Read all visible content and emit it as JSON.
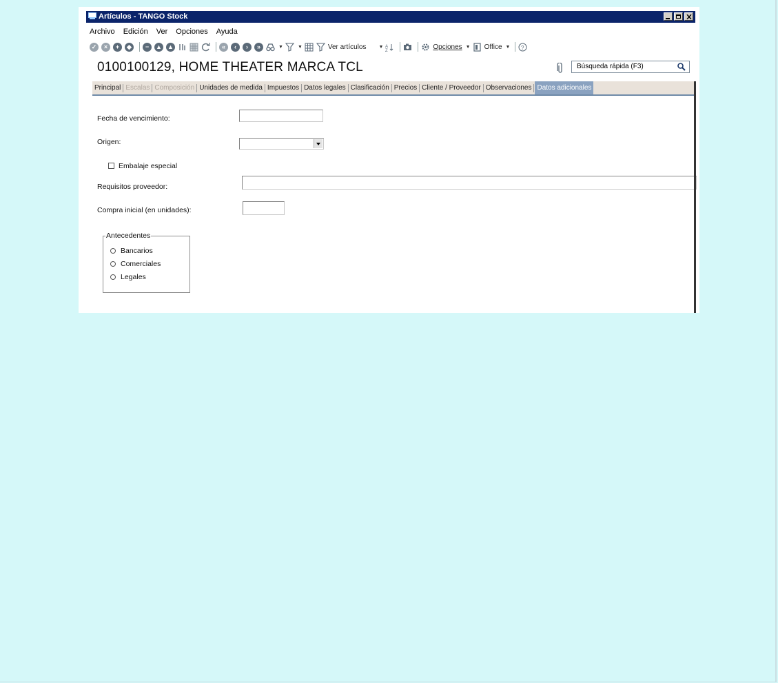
{
  "window": {
    "title": "Artículos - TANGO Stock"
  },
  "menu": [
    "Archivo",
    "Edición",
    "Ver",
    "Opciones",
    "Ayuda"
  ],
  "toolbar": {
    "view_label": "Ver artículos",
    "options_label": "Opciones",
    "office_label": "Office",
    "icons": [
      "check-icon",
      "cancel-icon",
      "add-icon",
      "copy-icon",
      "remove-icon",
      "up-icon",
      "down-icon",
      "columns-icon",
      "grid-icon",
      "refresh-icon",
      "first-icon",
      "prev-icon",
      "next-icon",
      "last-icon",
      "binoculars-icon",
      "filter-icon",
      "table-icon",
      "filter-view-icon",
      "sort-icon",
      "camera-icon",
      "gear-icon",
      "office-icon",
      "help-icon"
    ]
  },
  "header": {
    "title": "0100100129, HOME THEATER MARCA TCL",
    "search_placeholder": "Búsqueda rápida (F3)"
  },
  "tabs": [
    {
      "label": "Principal",
      "state": "normal"
    },
    {
      "label": "Escalas",
      "state": "disabled"
    },
    {
      "label": "Composición",
      "state": "disabled"
    },
    {
      "label": "Unidades de medida",
      "state": "normal"
    },
    {
      "label": "Impuestos",
      "state": "normal"
    },
    {
      "label": "Datos legales",
      "state": "normal"
    },
    {
      "label": "Clasificación",
      "state": "normal"
    },
    {
      "label": "Precios",
      "state": "normal"
    },
    {
      "label": "Cliente / Proveedor",
      "state": "normal"
    },
    {
      "label": "Observaciones",
      "state": "normal"
    },
    {
      "label": "Datos adicionales",
      "state": "active"
    }
  ],
  "form": {
    "fecha_label": "Fecha de vencimiento:",
    "fecha_value": "",
    "origen_label": "Origen:",
    "origen_value": "",
    "embalaje_label": "Embalaje especial",
    "embalaje_checked": false,
    "requisitos_label": "Requisitos proveedor:",
    "requisitos_value": "",
    "compra_label": "Compra inicial (en unidades):",
    "compra_value": "",
    "antecedentes": {
      "title": "Antecedentes",
      "options": [
        "Bancarios",
        "Comerciales",
        "Legales"
      ]
    }
  },
  "colors": {
    "titlebar": "#0b246a",
    "active_tab": "#8aa2c0",
    "page_background": "#d5f8f9"
  }
}
